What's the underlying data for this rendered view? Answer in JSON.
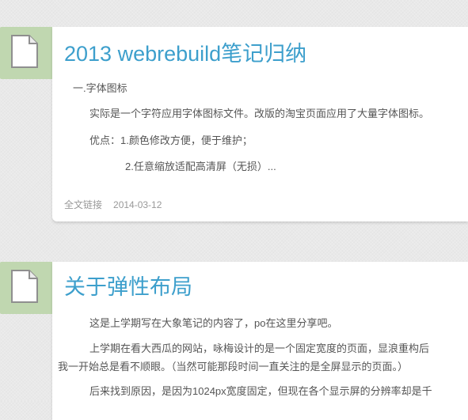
{
  "posts": [
    {
      "title": "2013 webrebuild笔记归纳",
      "lines": [
        "一.字体图标",
        "实际是一个字符应用字体图标文件。改版的淘宝页面应用了大量字体图标。",
        "优点：1.颜色修改方便，便于维护；",
        "2.任意缩放适配高清屏（无损）..."
      ],
      "read_more": "全文链接",
      "date": "2014-03-12"
    },
    {
      "title": "关于弹性布局",
      "lines": [
        "这是上学期写在大象笔记的内容了，po在这里分享吧。",
        "上学期在看大西瓜的网站，咏梅设计的是一个固定宽度的页面，显浪重构后",
        "我一开始总是看不顺眼。（当然可能那段时间一直关注的是全屏显示的页面。）",
        "后来找到原因，是因为1024px宽度固定，但现在各个显示屏的分辨率却是千"
      ]
    }
  ],
  "icons": {
    "post_badge": "document-icon"
  },
  "colors": {
    "title": "#3d9fcc",
    "badge": "#c0d7b0",
    "body_text": "#555555",
    "meta": "#999999"
  }
}
